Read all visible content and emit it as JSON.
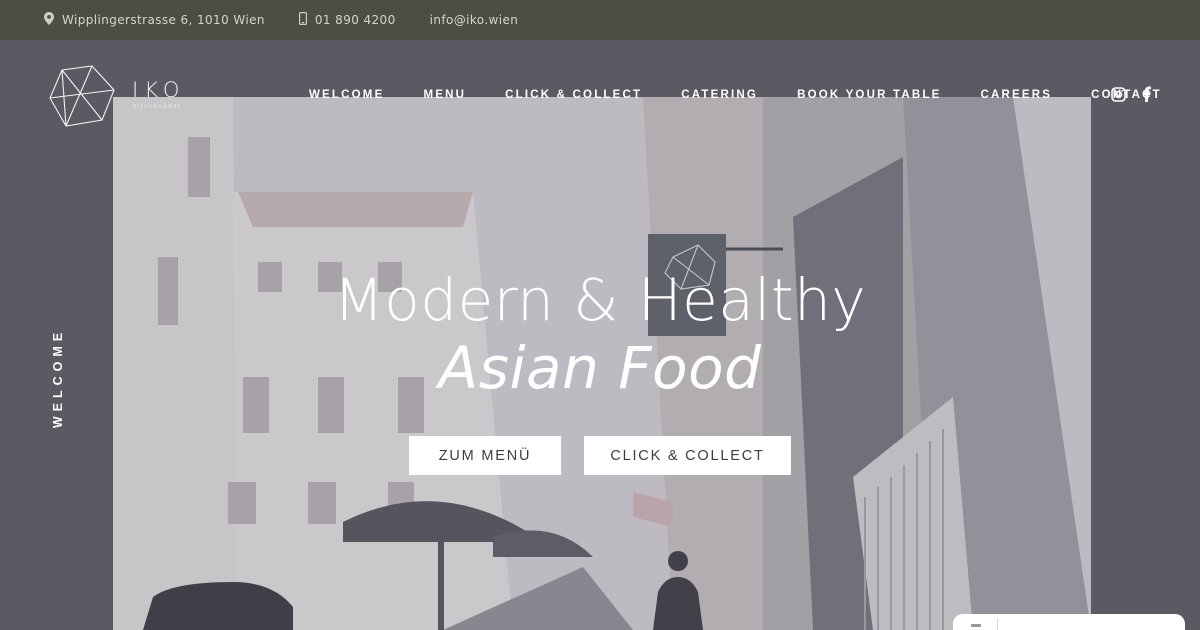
{
  "topbar": {
    "address": "Wipplingerstrasse 6, 1010 Wien",
    "phone": "01 890 4200",
    "email": "info@iko.wien",
    "icons": [
      "map-pin-icon",
      "phone-icon"
    ]
  },
  "brand": {
    "name": "IKO",
    "tagline": "Kitchen&bar"
  },
  "nav": {
    "items": [
      {
        "label": "WELCOME"
      },
      {
        "label": "MENU"
      },
      {
        "label": "CLICK & COLLECT"
      },
      {
        "label": "CATERING"
      },
      {
        "label": "BOOK YOUR TABLE"
      },
      {
        "label": "CAREERS"
      },
      {
        "label": "CONTACT"
      }
    ],
    "social_icons": [
      "instagram-icon",
      "facebook-icon"
    ]
  },
  "side_label": "WELCOME",
  "hero": {
    "line1": "Modern & Healthy",
    "line2": "Asian Food",
    "buttons": {
      "menu": "ZUM MENÜ",
      "collect": "CLICK & COLLECT"
    }
  },
  "colors": {
    "topbar": "#4d4c45",
    "background": "#5b5a62",
    "button_bg": "#ffffff",
    "button_text": "#3e3d44"
  }
}
